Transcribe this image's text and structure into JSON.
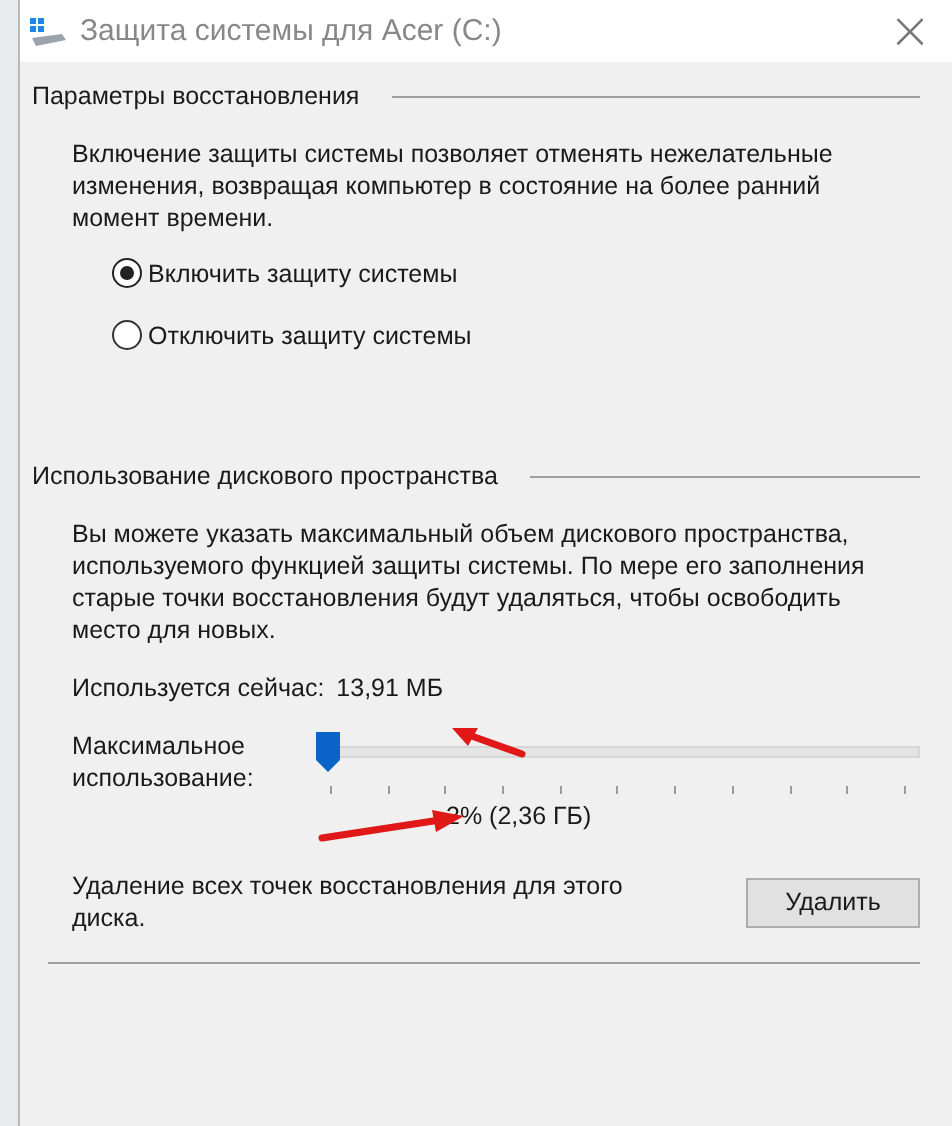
{
  "window": {
    "title": "Защита системы для Acer (C:)",
    "close": "×"
  },
  "restore_settings": {
    "heading": "Параметры восстановления",
    "description": "Включение защиты системы позволяет отменять нежелательные изменения, возвращая компьютер в состояние на более ранний момент времени.",
    "options": [
      {
        "label": "Включить защиту системы",
        "selected": true
      },
      {
        "label": "Отключить защиту системы",
        "selected": false
      }
    ]
  },
  "disk_usage": {
    "heading": "Использование дискового пространства",
    "description": "Вы можете указать максимальный объем дискового пространства, используемого функцией защиты системы. По мере его заполнения старые точки восстановления будут удаляться, чтобы освободить место для новых.",
    "current_label": "Используется сейчас:",
    "current_value": "13,91 МБ",
    "max_label": "Максимальное использование:",
    "max_slider": {
      "level": 0.02
    },
    "max_reading": "2% (2,36 ГБ)",
    "delete_text": "Удаление всех точек восстановления для этого диска.",
    "delete_button": "Удалить"
  }
}
